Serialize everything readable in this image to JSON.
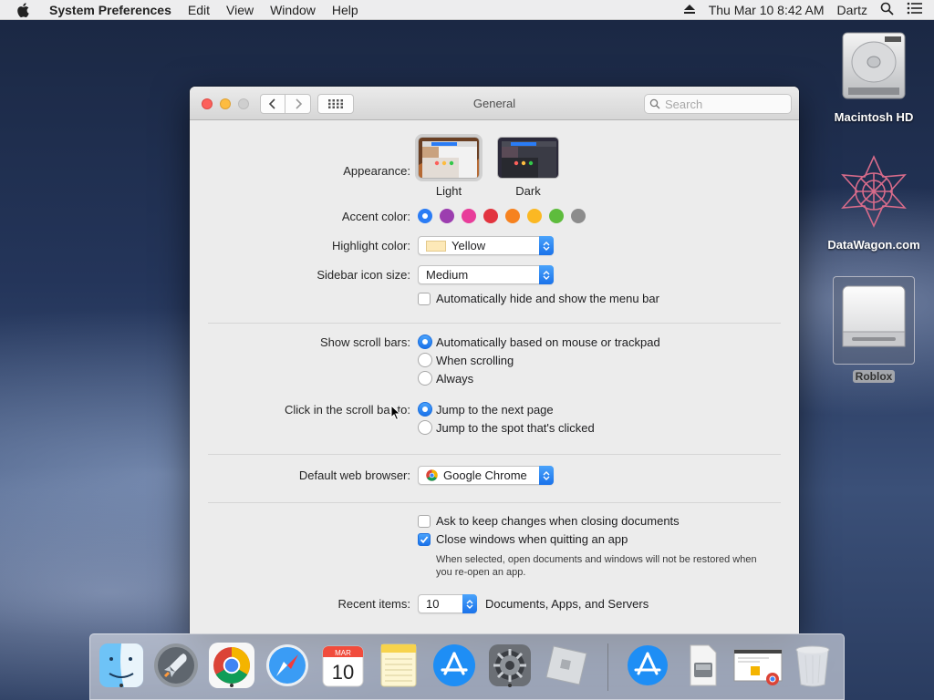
{
  "menubar": {
    "app_name": "System Preferences",
    "menus": [
      "Edit",
      "View",
      "Window",
      "Help"
    ],
    "datetime": "Thu Mar 10  8:42 AM",
    "user": "Dartz"
  },
  "desktop": {
    "icons": [
      {
        "label": "Macintosh HD"
      },
      {
        "label": "DataWagon.com"
      },
      {
        "label": "Roblox"
      }
    ]
  },
  "window": {
    "title": "General",
    "search_placeholder": "Search",
    "appearance": {
      "label": "Appearance:",
      "options": [
        "Light",
        "Dark"
      ],
      "selected": "Light"
    },
    "accent": {
      "label": "Accent color:",
      "colors": [
        "#2a7cf5",
        "#9c3eaf",
        "#e83d9a",
        "#e2343f",
        "#f6821f",
        "#fbb823",
        "#5ebc3d",
        "#8c8c8c"
      ],
      "selected_index": 0
    },
    "highlight": {
      "label": "Highlight color:",
      "value": "Yellow"
    },
    "sidebar_icon": {
      "label": "Sidebar icon size:",
      "value": "Medium"
    },
    "auto_hide_menu": {
      "label": "Automatically hide and show the menu bar",
      "checked": false
    },
    "scroll_bars": {
      "label": "Show scroll bars:",
      "options": [
        "Automatically based on mouse or trackpad",
        "When scrolling",
        "Always"
      ],
      "selected_index": 0
    },
    "click_scroll": {
      "label": "Click in the scroll bar to:",
      "options": [
        "Jump to the next page",
        "Jump to the spot that's clicked"
      ],
      "selected_index": 0
    },
    "browser": {
      "label": "Default web browser:",
      "value": "Google Chrome"
    },
    "ask_keep_changes": {
      "label": "Ask to keep changes when closing documents",
      "checked": false
    },
    "close_windows": {
      "label": "Close windows when quitting an app",
      "checked": true
    },
    "close_windows_note": "When selected, open documents and windows will not be restored when you re-open an app.",
    "recent_items": {
      "label": "Recent items:",
      "value": "10",
      "suffix": "Documents, Apps, and Servers"
    }
  },
  "dock": {
    "apps": [
      "finder",
      "launchpad",
      "chrome",
      "safari",
      "calendar",
      "notes",
      "app-store",
      "system-preferences",
      "roblox",
      "app-store-download",
      "disk-utility-doc",
      "chrome-installer",
      "trash"
    ],
    "calendar_month": "MAR",
    "calendar_day": "10"
  },
  "colors": {
    "accent_blue": "#1a72ea",
    "window_bg": "#ececec"
  }
}
